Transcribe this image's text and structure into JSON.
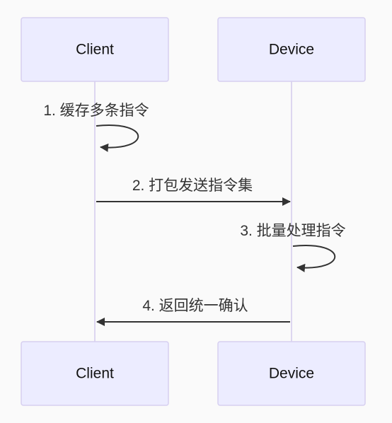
{
  "diagram": {
    "type": "sequence",
    "participants": [
      {
        "id": "client",
        "label": "Client"
      },
      {
        "id": "device",
        "label": "Device"
      }
    ],
    "messages": [
      {
        "number": "1.",
        "text": "缓存多条指令",
        "label": "1. 缓存多条指令",
        "from": "client",
        "to": "client"
      },
      {
        "number": "2.",
        "text": "打包发送指令集",
        "label": "2. 打包发送指令集",
        "from": "client",
        "to": "device"
      },
      {
        "number": "3.",
        "text": "批量处理指令",
        "label": "3. 批量处理指令",
        "from": "device",
        "to": "device"
      },
      {
        "number": "4.",
        "text": "返回统一确认",
        "label": "4. 返回统一确认",
        "from": "device",
        "to": "client"
      }
    ]
  }
}
